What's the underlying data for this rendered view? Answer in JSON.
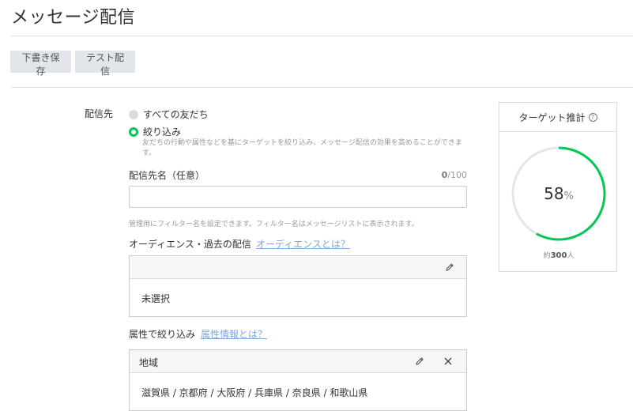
{
  "page": {
    "title": "メッセージ配信"
  },
  "toolbar": {
    "draft_label": "下書き保存",
    "test_label": "テスト配信"
  },
  "form": {
    "field_label": "配信先",
    "radio_all": "すべての友だち",
    "radio_filter": "絞り込み",
    "filter_description": "友だちの行動や属性などを基にターゲットを絞り込み、メッセージ配信の効果を高めることができます。",
    "name_label": "配信先名（任意）",
    "name_count": "0",
    "name_max": "/100",
    "name_value": "",
    "name_hint": "管理用にフィルター名を設定できます。フィルター名はメッセージリストに表示されます。",
    "audience_label": "オーディエンス・過去の配信",
    "audience_link": "オーディエンスとは？",
    "audience_value": "未選択",
    "attr_label": "属性で絞り込み",
    "attr_link": "属性情報とは？",
    "region_title": "地域",
    "region_value": "滋賀県 / 京都府 / 大阪府 / 兵庫県 / 奈良県 / 和歌山県"
  },
  "target": {
    "title": "ターゲット推計",
    "percent": 58,
    "percent_text": "58",
    "percent_unit": "%",
    "approx_prefix": "約",
    "approx_count": "300",
    "approx_suffix": "人"
  },
  "colors": {
    "accent": "#06c755",
    "link": "#7fa6d6",
    "track": "#e6e6e6"
  }
}
